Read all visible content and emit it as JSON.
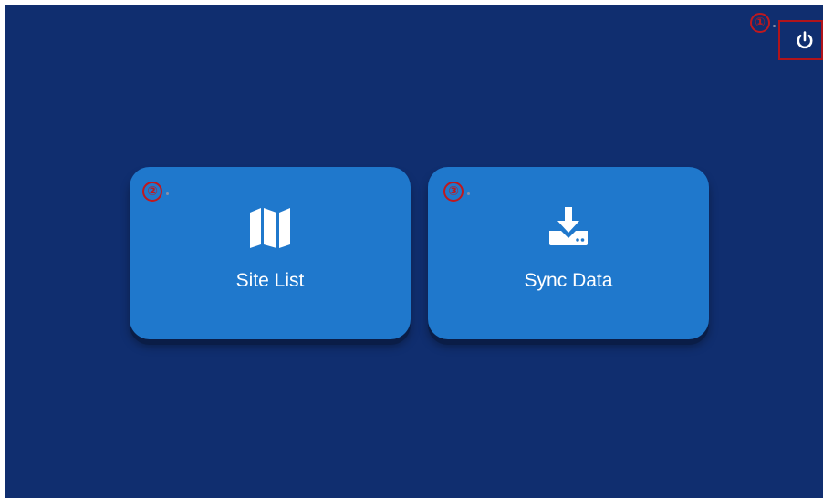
{
  "callouts": {
    "one": "①",
    "two": "②",
    "three": "③"
  },
  "power": {
    "icon": "power-icon"
  },
  "tiles": [
    {
      "label": "Site List",
      "icon": "map-icon"
    },
    {
      "label": "Sync Data",
      "icon": "download-icon"
    }
  ],
  "colors": {
    "background": "#102e6f",
    "tile": "#1f78cc",
    "annotation": "#c0181d"
  }
}
